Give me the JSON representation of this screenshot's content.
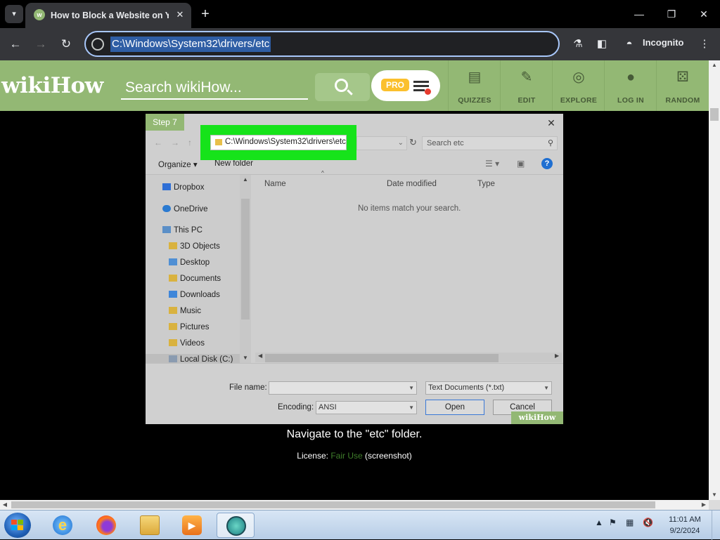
{
  "browser": {
    "tab_title": "How to Block a Website on Your",
    "tab_favicon_letter": "w",
    "address": "C:\\Windows\\System32\\drivers/etc",
    "incognito_label": "Incognito"
  },
  "wikihow": {
    "logo_wiki": "wiki",
    "logo_how": "How",
    "search_placeholder": "Search wikiHow...",
    "pro_label": "PRO",
    "nav": [
      {
        "label": "QUIZZES",
        "icon": "quizzes-icon"
      },
      {
        "label": "EDIT",
        "icon": "pencil-icon"
      },
      {
        "label": "EXPLORE",
        "icon": "compass-icon"
      },
      {
        "label": "LOG IN",
        "icon": "user-icon"
      },
      {
        "label": "RANDOM",
        "icon": "dice-icon"
      }
    ]
  },
  "step": {
    "label": "Step 7",
    "caption": "Navigate to the \"etc\" folder.",
    "license_prefix": "License:",
    "license_link": "Fair Use",
    "license_suffix": "(screenshot)",
    "watermark": "wikiHow"
  },
  "dialog": {
    "address_path": "C:\\Windows\\System32\\drivers\\etc",
    "search_placeholder": "Search etc",
    "organize_label": "Organize ▾",
    "new_folder_label": "New folder",
    "nav_items": [
      {
        "label": "Dropbox",
        "icon": "dropbox-icon"
      },
      {
        "label": "OneDrive",
        "icon": "onedrive-icon"
      },
      {
        "label": "This PC",
        "icon": "computer-icon"
      },
      {
        "label": "3D Objects",
        "icon": "folder-icon"
      },
      {
        "label": "Desktop",
        "icon": "folder-icon"
      },
      {
        "label": "Documents",
        "icon": "folder-icon"
      },
      {
        "label": "Downloads",
        "icon": "folder-icon"
      },
      {
        "label": "Music",
        "icon": "folder-icon"
      },
      {
        "label": "Pictures",
        "icon": "folder-icon"
      },
      {
        "label": "Videos",
        "icon": "folder-icon"
      },
      {
        "label": "Local Disk (C:)",
        "icon": "drive-icon"
      }
    ],
    "columns": {
      "name": "Name",
      "date": "Date modified",
      "type": "Type"
    },
    "empty_message": "No items match your search.",
    "file_name_label": "File name:",
    "file_name_value": "",
    "file_type_value": "Text Documents (*.txt)",
    "encoding_label": "Encoding:",
    "encoding_value": "ANSI",
    "open_label": "Open",
    "cancel_label": "Cancel"
  },
  "taskbar": {
    "time": "11:01 AM",
    "date": "9/2/2024"
  }
}
